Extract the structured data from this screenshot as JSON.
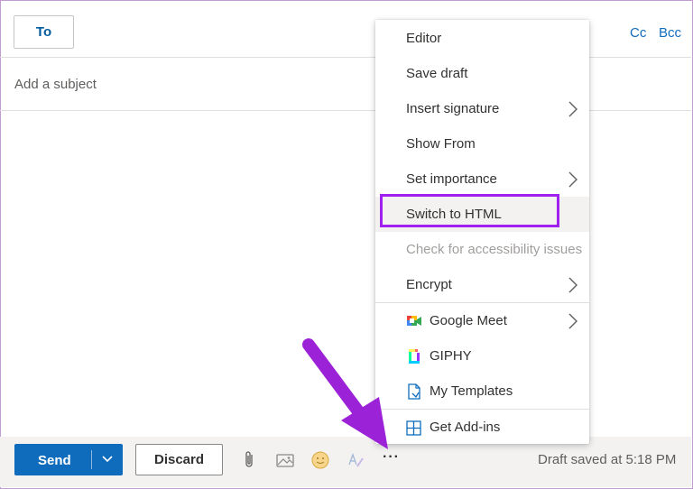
{
  "compose": {
    "to_label": "To",
    "cc_label": "Cc",
    "bcc_label": "Bcc",
    "subject_placeholder": "Add a subject"
  },
  "toolbar": {
    "send_label": "Send",
    "discard_label": "Discard",
    "more_label": "···",
    "draft_status": "Draft saved at 5:18 PM"
  },
  "menu": {
    "items": [
      {
        "label": "Editor"
      },
      {
        "label": "Save draft"
      },
      {
        "label": "Insert signature",
        "submenu": true
      },
      {
        "label": "Show From"
      },
      {
        "label": "Set importance",
        "submenu": true
      },
      {
        "label": "Switch to HTML",
        "highlighted": true
      },
      {
        "label": "Check for accessibility issues",
        "disabled": true
      },
      {
        "label": "Encrypt",
        "submenu": true
      },
      {
        "label": "Google Meet",
        "icon": "google-meet-icon",
        "submenu": true
      },
      {
        "label": "GIPHY",
        "icon": "giphy-icon"
      },
      {
        "label": "My Templates",
        "icon": "templates-icon"
      },
      {
        "label": "Get Add-ins",
        "icon": "add-ins-icon"
      }
    ]
  },
  "colors": {
    "accent": "#0f6cbd",
    "highlight": "#a020f0",
    "arrow": "#9b22d6"
  }
}
